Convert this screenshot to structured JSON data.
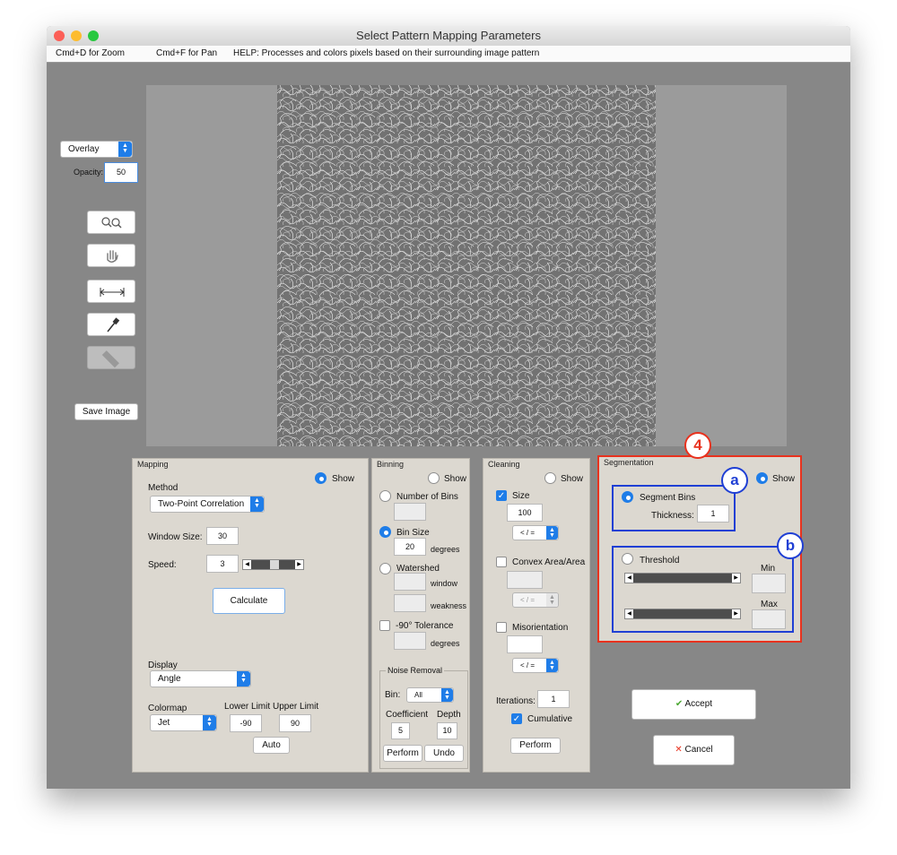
{
  "window": {
    "title": "Select Pattern Mapping Parameters"
  },
  "menubar": {
    "zoom": "Cmd+D for Zoom",
    "pan": "Cmd+F for Pan",
    "help": "HELP:  Processes and colors pixels based on their surrounding image pattern"
  },
  "left_tools": {
    "view_mode": "Overlay",
    "opacity_label": "Opacity:",
    "opacity_value": "50",
    "save_label": "Save Image"
  },
  "mapping": {
    "title": "Mapping",
    "show": "Show",
    "method_label": "Method",
    "method_value": "Two-Point Correlation",
    "window_size_label": "Window Size:",
    "window_size_value": "30",
    "speed_label": "Speed:",
    "speed_value": "3",
    "speed_level": 0.55,
    "calculate": "Calculate",
    "display_label": "Display",
    "display_value": "Angle",
    "colormap_label": "Colormap",
    "colormap_value": "Jet",
    "lower_label": "Lower Limit",
    "lower_value": "-90",
    "upper_label": "Upper Limit",
    "upper_value": "90",
    "auto": "Auto"
  },
  "binning": {
    "title": "Binning",
    "show": "Show",
    "number_bins": "Number of Bins",
    "bin_size": "Bin Size",
    "bin_size_value": "20",
    "degrees": "degrees",
    "watershed": "Watershed",
    "window": "window",
    "weakness": "weakness",
    "tolerance": "-90° Tolerance",
    "degrees2": "degrees",
    "noise_title": "Noise Removal",
    "bin_label": "Bin:",
    "bin_value": "All",
    "coefficient_label": "Coefficient",
    "coefficient_value": "5",
    "depth_label": "Depth",
    "depth_value": "10",
    "perform": "Perform",
    "undo": "Undo"
  },
  "cleaning": {
    "title": "Cleaning",
    "show": "Show",
    "size": "Size",
    "size_value": "100",
    "size_op": "< / =",
    "convex": "Convex Area/Area",
    "convex_op": "< / =",
    "misorientation": "Misorientation",
    "mis_op": "< / =",
    "iterations_label": "Iterations:",
    "iterations_value": "1",
    "cumulative": "Cumulative",
    "perform": "Perform"
  },
  "segmentation": {
    "title": "Segmentation",
    "show": "Show",
    "segment_bins": "Segment Bins",
    "thickness_label": "Thickness:",
    "thickness_value": "1",
    "threshold": "Threshold",
    "min_label": "Min",
    "max_label": "Max"
  },
  "actions": {
    "accept": "Accept",
    "cancel": "Cancel",
    "accept_icon": "✔",
    "cancel_icon": "✕"
  },
  "annotations": {
    "step": "4",
    "a": "a",
    "b": "b"
  },
  "colors": {
    "accent": "#1f7de8",
    "annot_red": "#e8321e",
    "annot_blue": "#1f3fd4"
  }
}
